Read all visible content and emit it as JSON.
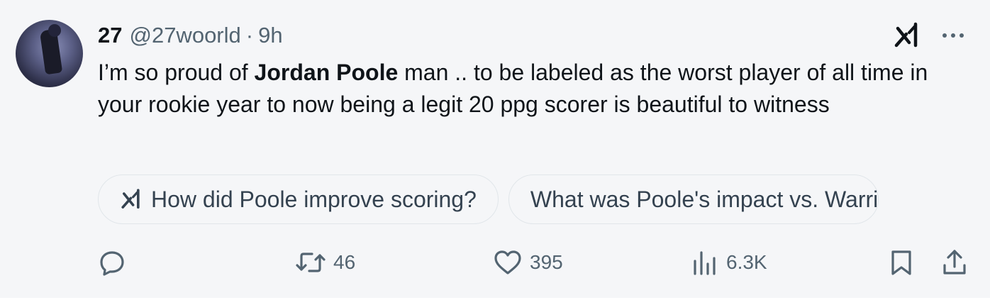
{
  "tweet": {
    "display_name": "27",
    "handle": "@27woorld",
    "separator": "·",
    "time": "9h",
    "text_before": "I’m so proud of ",
    "text_bold": "Jordan Poole",
    "text_after": " man .. to be labeled as the worst player of all time in your rookie year to now being a legit 20 ppg scorer is beautiful to witness"
  },
  "grok_suggestions": [
    {
      "label": "How did Poole improve scoring?"
    },
    {
      "label": "What was Poole's impact vs. Warri"
    }
  ],
  "actions": {
    "reply_count": "",
    "retweet_count": "46",
    "like_count": "395",
    "views_count": "6.3K"
  },
  "icons": {
    "grok": "grok-icon",
    "more": "more-icon",
    "reply": "reply-icon",
    "retweet": "retweet-icon",
    "like": "heart-icon",
    "views": "views-icon",
    "bookmark": "bookmark-icon",
    "share": "share-icon"
  },
  "colors": {
    "text_primary": "#0f1419",
    "text_secondary": "#536471",
    "background": "#f5f6f8",
    "chip_border": "#e1e6ea"
  }
}
